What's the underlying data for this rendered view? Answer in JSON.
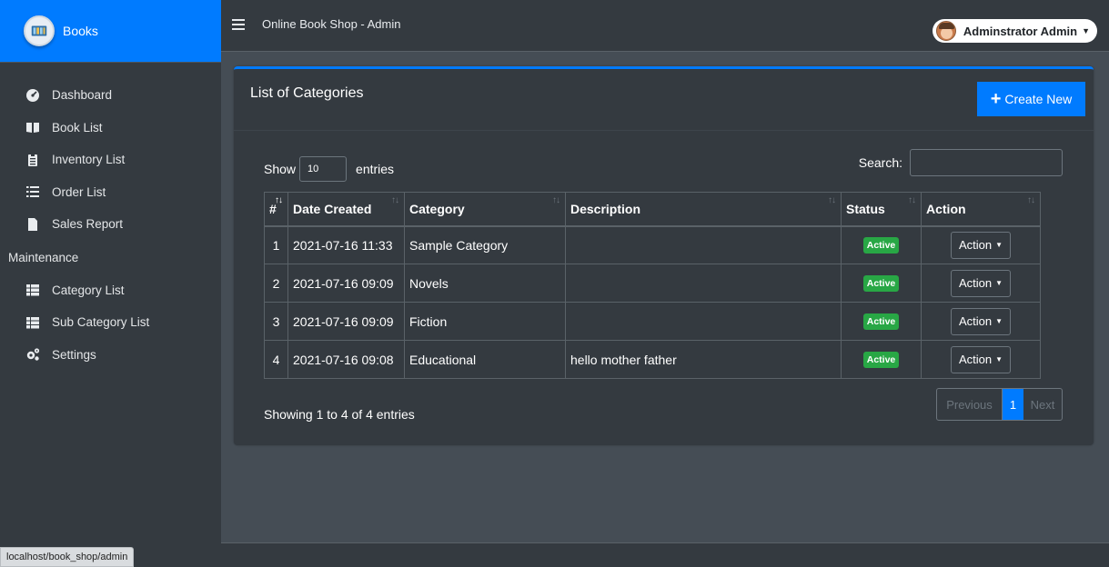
{
  "brand": {
    "title": "Books"
  },
  "sidebar": {
    "items": [
      {
        "label": "Dashboard",
        "icon": "dashboard-icon"
      },
      {
        "label": "Book List",
        "icon": "book-open-icon"
      },
      {
        "label": "Inventory List",
        "icon": "clipboard-list-icon"
      },
      {
        "label": "Order List",
        "icon": "list-icon"
      },
      {
        "label": "Sales Report",
        "icon": "file-icon"
      }
    ],
    "maintenance_header": "Maintenance",
    "maintenance_items": [
      {
        "label": "Category List",
        "icon": "table-list-icon"
      },
      {
        "label": "Sub Category List",
        "icon": "table-list-icon"
      },
      {
        "label": "Settings",
        "icon": "cogs-icon"
      }
    ]
  },
  "topbar": {
    "app_title": "Online Book Shop - Admin",
    "user_name": "Adminstrator Admin"
  },
  "card": {
    "title": "List of Categories",
    "create_label": "Create New"
  },
  "table_controls": {
    "show_label": "Show",
    "entries_value": "10",
    "entries_label": "entries",
    "search_label": "Search:"
  },
  "table": {
    "headers": [
      "#",
      "Date Created",
      "Category",
      "Description",
      "Status",
      "Action"
    ],
    "rows": [
      {
        "num": "1",
        "date": "2021-07-16 11:33",
        "category": "Sample Category",
        "description": "",
        "status": "Active",
        "action": "Action"
      },
      {
        "num": "2",
        "date": "2021-07-16 09:09",
        "category": "Novels",
        "description": "",
        "status": "Active",
        "action": "Action"
      },
      {
        "num": "3",
        "date": "2021-07-16 09:09",
        "category": "Fiction",
        "description": "",
        "status": "Active",
        "action": "Action"
      },
      {
        "num": "4",
        "date": "2021-07-16 09:08",
        "category": "Educational",
        "description": "hello mother father",
        "status": "Active",
        "action": "Action"
      }
    ]
  },
  "footer": {
    "info": "Showing 1 to 4 of 4 entries",
    "prev": "Previous",
    "page": "1",
    "next": "Next"
  },
  "statusbar": {
    "url": "localhost/book_shop/admin"
  },
  "colors": {
    "accent": "#007bff",
    "sidebar_bg": "#343a40",
    "content_bg": "#454d55",
    "status_active": "#28a745"
  }
}
